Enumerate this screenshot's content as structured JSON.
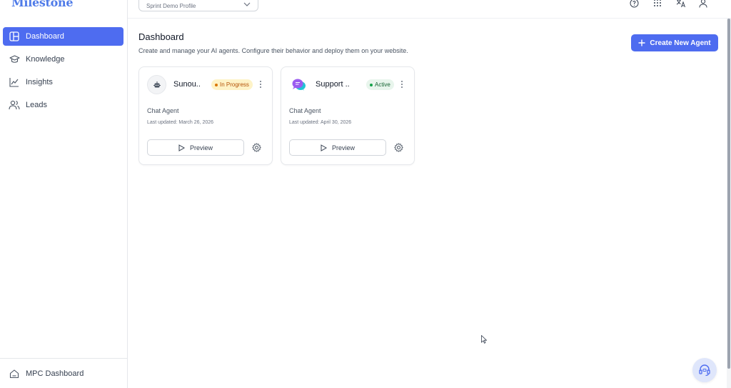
{
  "brand": {
    "logo_text": "Milestone",
    "accent": "#4e6cf0"
  },
  "sidebar": {
    "items": [
      {
        "label": "Dashboard",
        "icon": "dashboard-icon",
        "active": true
      },
      {
        "label": "Knowledge",
        "icon": "graduation-cap-icon",
        "active": false
      },
      {
        "label": "Insights",
        "icon": "line-chart-icon",
        "active": false
      },
      {
        "label": "Leads",
        "icon": "users-icon",
        "active": false
      }
    ],
    "footer": {
      "label": "MPC Dashboard",
      "icon": "home-icon"
    }
  },
  "topbar": {
    "profile_select": "Sprint Demo Profile",
    "icons": [
      "help-icon",
      "apps-grid-icon",
      "translate-icon",
      "user-icon"
    ]
  },
  "main": {
    "title": "Dashboard",
    "subtitle": "Create and manage your AI agents. Configure their behavior and deploy them on your website.",
    "create_button": "Create New Agent"
  },
  "agents": [
    {
      "name": "Sunou..",
      "status": "In Progress",
      "status_color": "#d97706",
      "status_bg": "#fef3c7",
      "type": "Chat Agent",
      "updated": "Last updated: March 26, 2026",
      "preview_label": "Preview",
      "avatar_icon": "robot-icon"
    },
    {
      "name": "Support ..",
      "status": "Active",
      "status_color": "#15803d",
      "status_bg": "#e8f5ec",
      "type": "Chat Agent",
      "updated": "Last updated: April 30, 2026",
      "preview_label": "Preview",
      "avatar_icon": "chat-bubbles-icon"
    }
  ]
}
